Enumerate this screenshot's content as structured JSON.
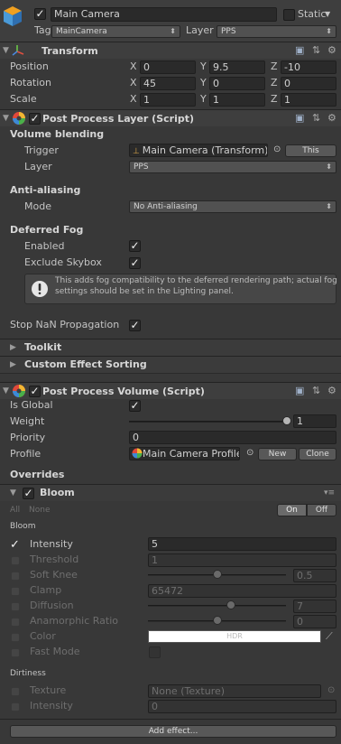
{
  "object": {
    "name": "Main Camera",
    "static_label": "Static",
    "tag_label": "Tag",
    "tag_value": "MainCamera",
    "layer_label": "Layer",
    "layer_value": "PPS"
  },
  "transform": {
    "title": "Transform",
    "rows": [
      {
        "label": "Position",
        "x": "0",
        "y": "9.5",
        "z": "-10"
      },
      {
        "label": "Rotation",
        "x": "45",
        "y": "0",
        "z": "0"
      },
      {
        "label": "Scale",
        "x": "1",
        "y": "1",
        "z": "1"
      }
    ],
    "axis": {
      "x": "X",
      "y": "Y",
      "z": "Z"
    }
  },
  "ppl": {
    "title": "Post Process Layer (Script)",
    "volume_blending": "Volume blending",
    "trigger_label": "Trigger",
    "trigger_value": "Main Camera (Transform)",
    "this_button": "This",
    "layer_label": "Layer",
    "layer_value": "PPS",
    "aa_heading": "Anti-aliasing",
    "mode_label": "Mode",
    "mode_value": "No Anti-aliasing",
    "fog_heading": "Deferred Fog",
    "enabled_label": "Enabled",
    "exclude_skybox_label": "Exclude Skybox",
    "info_text_1": "This adds fog compatibility to the deferred rendering path; actual fog",
    "info_text_2": "settings should be set in the Lighting panel.",
    "stop_nan_label": "Stop NaN Propagation",
    "toolkit_label": "Toolkit",
    "custom_sorting_label": "Custom Effect Sorting"
  },
  "ppv": {
    "title": "Post Process Volume (Script)",
    "is_global_label": "Is Global",
    "weight_label": "Weight",
    "weight_value": "1",
    "weight_fraction": 1.0,
    "priority_label": "Priority",
    "priority_value": "0",
    "profile_label": "Profile",
    "profile_value": "Main Camera Profile",
    "new_button": "New",
    "clone_button": "Clone",
    "overrides_heading": "Overrides"
  },
  "bloom": {
    "title": "Bloom",
    "all_label": "All",
    "none_label": "None",
    "on_label": "On",
    "off_label": "Off",
    "section_bloom": "Bloom",
    "intensity_label": "Intensity",
    "intensity_value": "5",
    "threshold_label": "Threshold",
    "threshold_value": "1",
    "soft_knee_label": "Soft Knee",
    "soft_knee_value": "0.5",
    "soft_knee_fraction": 0.5,
    "clamp_label": "Clamp",
    "clamp_value": "65472",
    "diffusion_label": "Diffusion",
    "diffusion_value": "7",
    "diffusion_fraction": 0.6,
    "anamorphic_label": "Anamorphic Ratio",
    "anamorphic_value": "0",
    "anamorphic_fraction": 0.5,
    "color_label": "Color",
    "color_value": "HDR",
    "fast_mode_label": "Fast Mode",
    "section_dirtiness": "Dirtiness",
    "texture_label": "Texture",
    "texture_value": "None (Texture)",
    "dirt_intensity_label": "Intensity",
    "dirt_intensity_value": "0"
  },
  "add_effect_label": "Add effect..."
}
